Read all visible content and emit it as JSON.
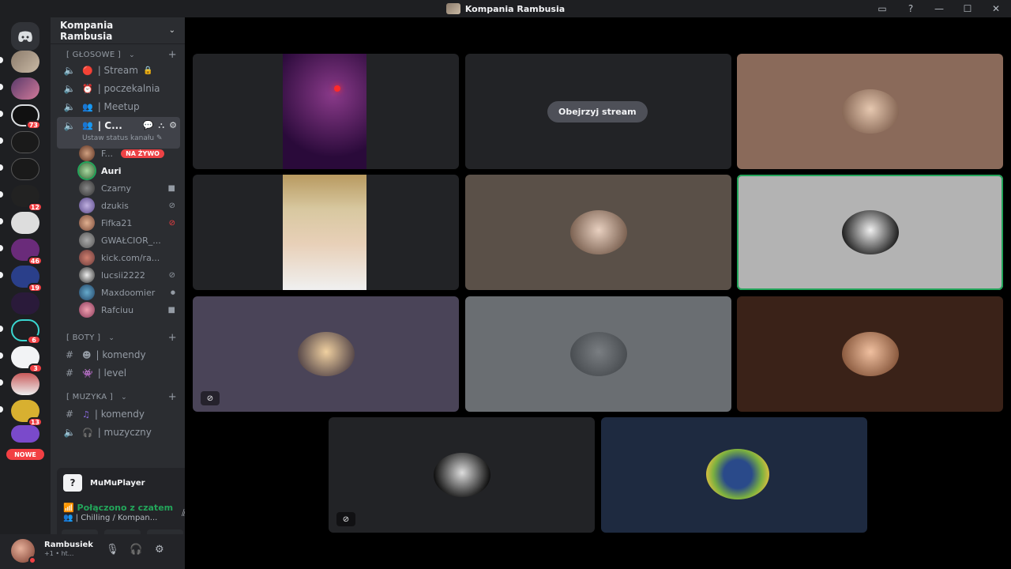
{
  "window": {
    "title": "Kompania Rambusia"
  },
  "rail": {
    "badges": [
      "73",
      "12",
      "46",
      "19",
      "6",
      "3",
      "13"
    ],
    "new_label": "NOWE"
  },
  "guild": {
    "name": "Kompania Rambusia"
  },
  "categories": {
    "voice": "[ GŁOSOWE ]",
    "bots": "[ BOTY ]",
    "music": "[ MUZYKA ]"
  },
  "channels": {
    "stream": "| Stream",
    "waiting": "| poczekalnia",
    "meetup": "| Meetup",
    "active": "| C...",
    "active_status": "Ustaw status kanału",
    "commands_bots": "| komendy",
    "level": "| level",
    "commands_music": "| komendy",
    "music": "| muzyczny"
  },
  "voice_users": [
    {
      "name": "F...",
      "badge": "NA ŻYWO"
    },
    {
      "name": "Auri"
    },
    {
      "name": "Czarny"
    },
    {
      "name": "dzukis"
    },
    {
      "name": "Fifka21"
    },
    {
      "name": "GWAŁCIOR_..."
    },
    {
      "name": "kick.com/ra..."
    },
    {
      "name": "lucsii2222"
    },
    {
      "name": "Maxdoomier"
    },
    {
      "name": "Rafciuu"
    }
  ],
  "voice_panel": {
    "app_name": "MuMuPlayer",
    "connected": "Połączono z czatem",
    "channel": "| Chilling / Kompan..."
  },
  "user": {
    "name": "Rambusiek",
    "sub": "+1 • ht..."
  },
  "stage": {
    "watch_stream": "Obejrzyj stream"
  },
  "colors": {
    "accent_green": "#23a55a",
    "danger": "#f23f43",
    "sidebar": "#2b2d31",
    "rail": "#1e1f22"
  }
}
